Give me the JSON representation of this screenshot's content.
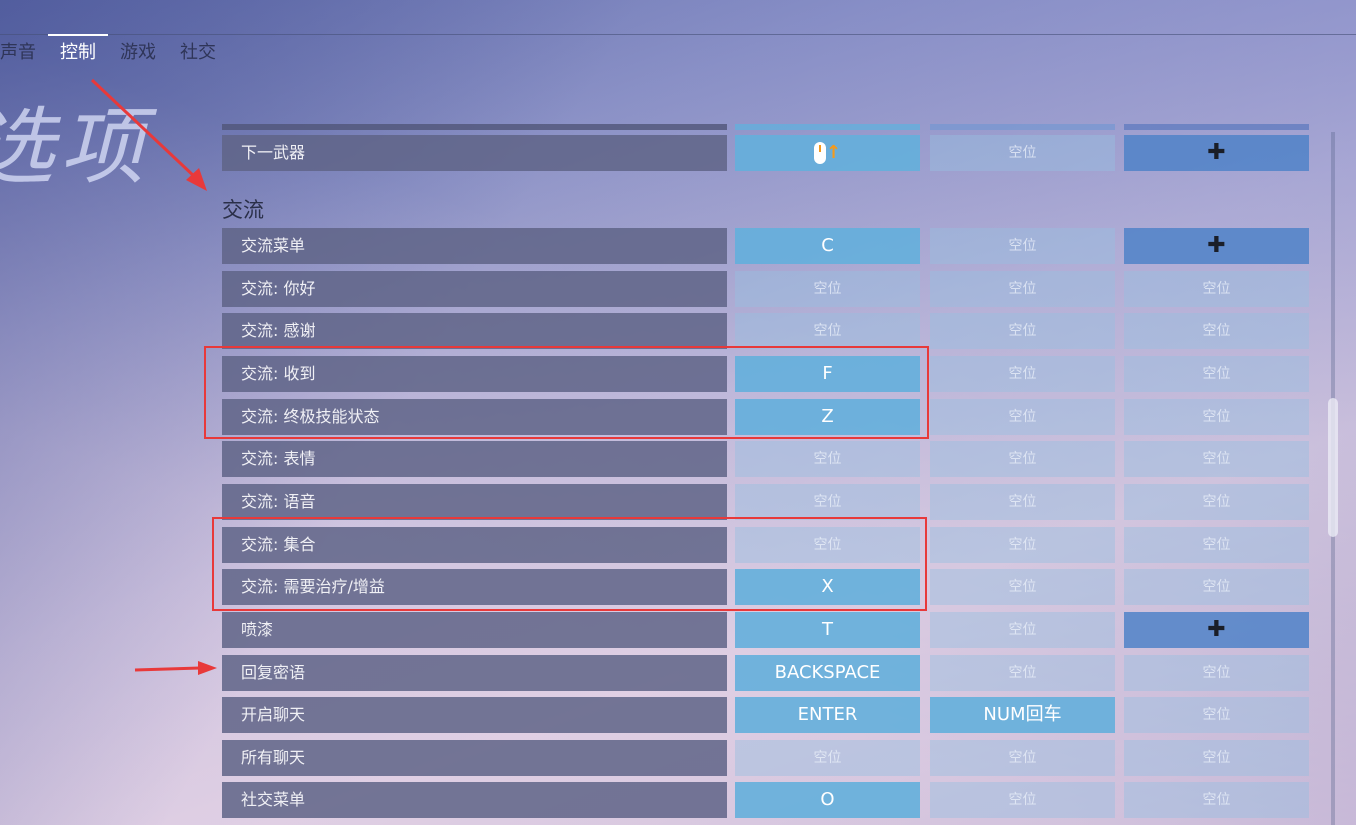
{
  "tabs": [
    {
      "label": "声音"
    },
    {
      "label": "控制",
      "active": true
    },
    {
      "label": "游戏"
    },
    {
      "label": "社交"
    }
  ],
  "page_title": "选项",
  "prev_row": {
    "label": "下一武器",
    "keys": [
      "mouse-wheel-up-icon",
      "空位",
      "dpad-icon"
    ]
  },
  "section_title": "交流",
  "rows": [
    {
      "label": "交流菜单",
      "keys": [
        "C",
        "空位",
        "dpad-icon"
      ]
    },
    {
      "label": "交流: 你好",
      "keys": [
        "空位",
        "空位",
        "空位"
      ]
    },
    {
      "label": "交流: 感谢",
      "keys": [
        "空位",
        "空位",
        "空位"
      ]
    },
    {
      "label": "交流: 收到",
      "keys": [
        "F",
        "空位",
        "空位"
      ]
    },
    {
      "label": "交流: 终极技能状态",
      "keys": [
        "Z",
        "空位",
        "空位"
      ]
    },
    {
      "label": "交流: 表情",
      "keys": [
        "空位",
        "空位",
        "空位"
      ]
    },
    {
      "label": "交流: 语音",
      "keys": [
        "空位",
        "空位",
        "空位"
      ]
    },
    {
      "label": "交流: 集合",
      "keys": [
        "空位",
        "空位",
        "空位"
      ]
    },
    {
      "label": "交流: 需要治疗/增益",
      "keys": [
        "X",
        "空位",
        "空位"
      ]
    },
    {
      "label": "喷漆",
      "keys": [
        "T",
        "空位",
        "dpad-icon"
      ]
    },
    {
      "label": "回复密语",
      "keys": [
        "BACKSPACE",
        "空位",
        "空位"
      ]
    },
    {
      "label": "开启聊天",
      "keys": [
        "ENTER",
        "NUM回车",
        "空位"
      ]
    },
    {
      "label": "所有聊天",
      "keys": [
        "空位",
        "空位",
        "空位"
      ]
    },
    {
      "label": "社交菜单",
      "keys": [
        "O",
        "空位",
        "空位"
      ]
    }
  ],
  "colors": {
    "bound": "#64afdc",
    "empty": "#96bee1",
    "label_bg": "#5f6487",
    "annotation": "#e8393a"
  }
}
